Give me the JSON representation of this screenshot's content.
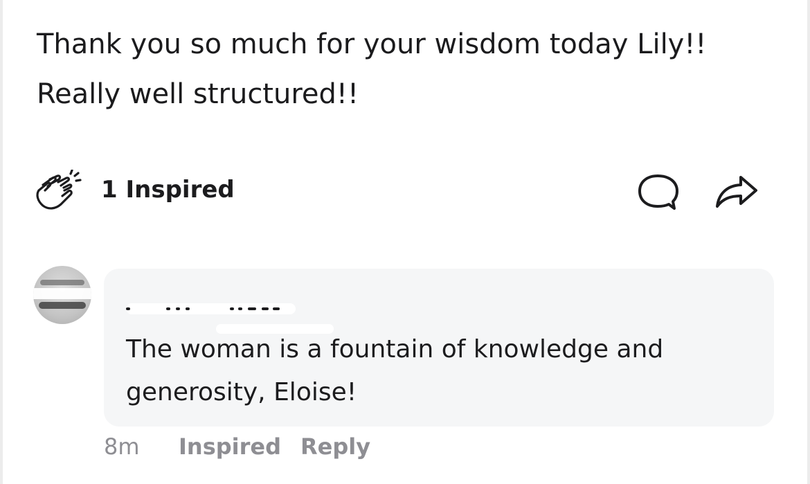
{
  "post": {
    "text_line1": "Thank you so much for your wisdom today Lily!!",
    "text_line2": "Really well structured!!"
  },
  "reactions": {
    "inspired_count_label": "1 Inspired",
    "clap_icon": "clapping-hands-icon",
    "comment_icon": "speech-bubble-icon",
    "share_icon": "share-arrow-icon"
  },
  "comment": {
    "author_redacted": true,
    "text_line1": "The woman is a fountain of knowledge and",
    "text_line2": "generosity, Eloise!",
    "time_ago": "8m",
    "inspired_label": "Inspired",
    "reply_label": "Reply"
  },
  "colors": {
    "text_primary": "#1c1c1e",
    "text_secondary": "#8e8e93",
    "bubble_background": "#f5f6f7"
  }
}
